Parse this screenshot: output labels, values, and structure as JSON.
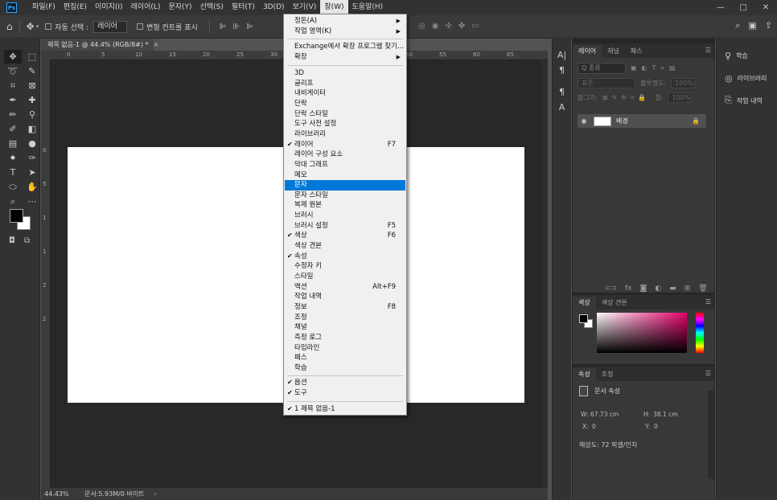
{
  "menubar": {
    "logo": "Ps",
    "items": [
      "파일(F)",
      "편집(E)",
      "이미지(I)",
      "레이어(L)",
      "문자(Y)",
      "선택(S)",
      "필터(T)",
      "3D(D)",
      "보기(V)",
      "창(W)",
      "도움말(H)"
    ],
    "active": "창(W)",
    "minimize": "—",
    "maximize": "□",
    "close": "✕"
  },
  "options": {
    "home_icon": "home-icon",
    "auto_select_label": "자동 선택 :",
    "auto_select_value": "레이어",
    "transform_label": "변형 컨트롤 표시"
  },
  "document": {
    "tab_title": "제목 없음-1 @ 44.4% (RGB/8#) *",
    "close": "×",
    "zoom": "44.43%",
    "doc_size": "문서:5.93M/0 바이트",
    "ruler_h": [
      "0",
      "5",
      "10",
      "15",
      "20",
      "25",
      "30",
      "35",
      "40",
      "45",
      "50",
      "55",
      "60",
      "65"
    ],
    "ruler_v": [
      "0",
      "5",
      "1",
      "1",
      "2",
      "2"
    ]
  },
  "window_menu": {
    "arrange": "정돈(A)",
    "workspace": "작업 영역(K)",
    "find_extensions": "Exchange에서 확장 프로그램 찾기...",
    "extensions": "확장",
    "items": [
      {
        "label": "3D",
        "checked": false,
        "shortcut": ""
      },
      {
        "label": "글리프",
        "checked": false,
        "shortcut": ""
      },
      {
        "label": "내비게이터",
        "checked": false,
        "shortcut": ""
      },
      {
        "label": "단락",
        "checked": false,
        "shortcut": ""
      },
      {
        "label": "단락 스타일",
        "checked": false,
        "shortcut": ""
      },
      {
        "label": "도구 사전 설정",
        "checked": false,
        "shortcut": ""
      },
      {
        "label": "라이브러리",
        "checked": false,
        "shortcut": ""
      },
      {
        "label": "레이어",
        "checked": true,
        "shortcut": "F7"
      },
      {
        "label": "레이어 구성 요소",
        "checked": false,
        "shortcut": ""
      },
      {
        "label": "막대 그래프",
        "checked": false,
        "shortcut": ""
      },
      {
        "label": "메모",
        "checked": false,
        "shortcut": ""
      },
      {
        "label": "문자",
        "checked": false,
        "shortcut": "",
        "highlighted": true
      },
      {
        "label": "문자 스타일",
        "checked": false,
        "shortcut": ""
      },
      {
        "label": "복제 원본",
        "checked": false,
        "shortcut": ""
      },
      {
        "label": "브러시",
        "checked": false,
        "shortcut": ""
      },
      {
        "label": "브러시 설정",
        "checked": false,
        "shortcut": "F5"
      },
      {
        "label": "색상",
        "checked": true,
        "shortcut": "F6"
      },
      {
        "label": "색상 견본",
        "checked": false,
        "shortcut": ""
      },
      {
        "label": "속성",
        "checked": true,
        "shortcut": ""
      },
      {
        "label": "수정자 키",
        "checked": false,
        "shortcut": ""
      },
      {
        "label": "스타일",
        "checked": false,
        "shortcut": ""
      },
      {
        "label": "액션",
        "checked": false,
        "shortcut": "Alt+F9"
      },
      {
        "label": "작업 내역",
        "checked": false,
        "shortcut": ""
      },
      {
        "label": "정보",
        "checked": false,
        "shortcut": "F8"
      },
      {
        "label": "조정",
        "checked": false,
        "shortcut": ""
      },
      {
        "label": "채널",
        "checked": false,
        "shortcut": ""
      },
      {
        "label": "측정 로그",
        "checked": false,
        "shortcut": ""
      },
      {
        "label": "타임라인",
        "checked": false,
        "shortcut": ""
      },
      {
        "label": "패스",
        "checked": false,
        "shortcut": ""
      },
      {
        "label": "학습",
        "checked": false,
        "shortcut": ""
      }
    ],
    "options": "옵션",
    "tools": "도구",
    "document": "1 제목 없음-1"
  },
  "layers_panel": {
    "tabs": [
      "레이어",
      "채널",
      "패스"
    ],
    "filter_placeholder": "Q 종류",
    "blend_mode": "표준",
    "opacity_label": "불투명도:",
    "opacity_value": "100%",
    "lock_label": "잠그기:",
    "fill_label": "칠:",
    "fill_value": "100%",
    "layer_name": "배경"
  },
  "color_panel": {
    "tabs": [
      "색상",
      "색상 견본"
    ]
  },
  "properties_panel": {
    "tabs": [
      "속성",
      "조정"
    ],
    "title": "문서 속성",
    "w_label": "W:",
    "w_value": "67.73 cm",
    "h_label": "H:",
    "h_value": "38.1 cm",
    "x_label": "X:",
    "x_value": "0",
    "y_label": "Y:",
    "y_value": "0",
    "resolution": "해상도: 72 픽셀/인치"
  },
  "learn_panel": {
    "items": [
      "학습",
      "라이브러리",
      "작업 내역"
    ]
  }
}
